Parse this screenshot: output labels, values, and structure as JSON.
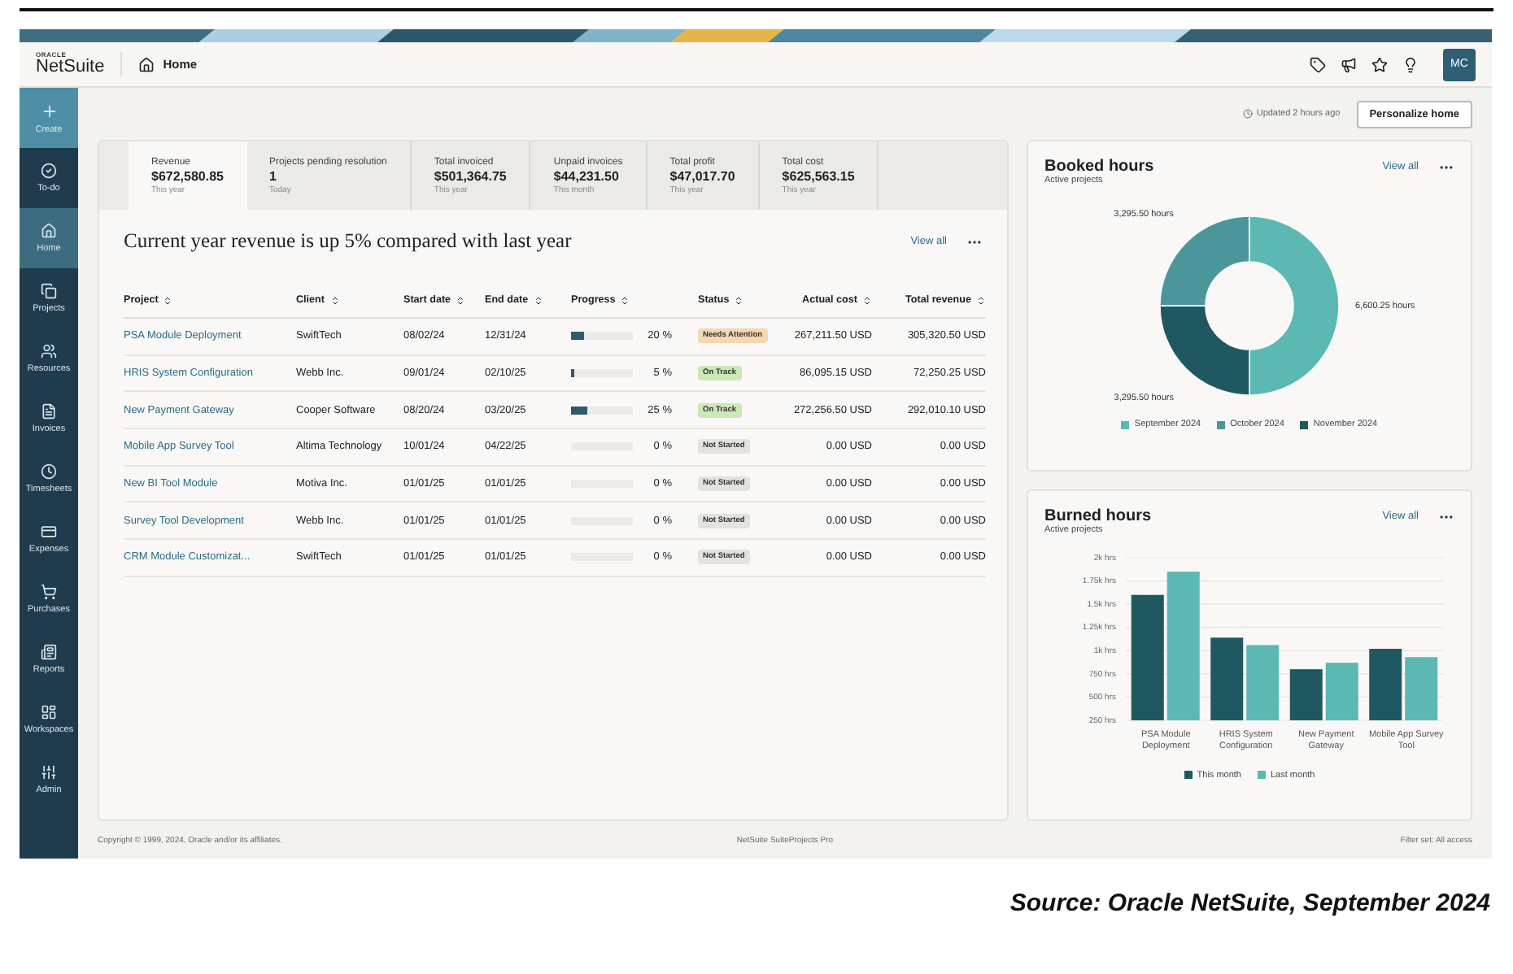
{
  "header": {
    "logo": {
      "company": "ORACLE",
      "product": "NetSuite"
    },
    "page": "Home",
    "avatar": "MC"
  },
  "sidebar": {
    "create": "Create",
    "items": [
      {
        "label": "To-do",
        "selected": false
      },
      {
        "label": "Home",
        "selected": true
      },
      {
        "label": "Projects",
        "selected": false
      },
      {
        "label": "Resources",
        "selected": false
      },
      {
        "label": "Invoices",
        "selected": false
      },
      {
        "label": "Timesheets",
        "selected": false
      },
      {
        "label": "Expenses",
        "selected": false
      },
      {
        "label": "Purchases",
        "selected": false
      },
      {
        "label": "Reports",
        "selected": false
      },
      {
        "label": "Workspaces",
        "selected": false
      },
      {
        "label": "Admin",
        "selected": false
      }
    ]
  },
  "toolbar": {
    "updated": "Updated 2 hours ago",
    "button": "Personalize home"
  },
  "summary_tabs": [
    {
      "label": "Revenue",
      "value": "$672,580.85",
      "period": "This year",
      "selected": true
    },
    {
      "label": "Projects pending resolution",
      "value": "1",
      "period": "Today",
      "selected": false
    },
    {
      "label": "Total invoiced",
      "value": "$501,364.75",
      "period": "This year",
      "selected": false
    },
    {
      "label": "Unpaid invoices",
      "value": "$44,231.50",
      "period": "This month",
      "selected": false
    },
    {
      "label": "Total profit",
      "value": "$47,017.70",
      "period": "This year",
      "selected": false
    },
    {
      "label": "Total cost",
      "value": "$625,563.15",
      "period": "This year",
      "selected": false
    }
  ],
  "revenue_card": {
    "heading": "Current year revenue is up 5% compared with last year",
    "view_all": "View all",
    "columns": [
      "Project",
      "Client",
      "Start date",
      "End date",
      "Progress",
      "Status",
      "Actual cost",
      "Total revenue"
    ],
    "rows": [
      {
        "project": "PSA Module Deployment",
        "client": "SwiftTech",
        "start": "08/02/24",
        "end": "12/31/24",
        "progress": {
          "level": 0.2,
          "reading": "20 %"
        },
        "status": {
          "label": "Needs Attention",
          "color": "#f6d7b0"
        },
        "actual_cost": "267,211.50 USD",
        "total_revenue": "305,320.50 USD"
      },
      {
        "project": "HRIS System Configuration",
        "client": "Webb Inc.",
        "start": "09/01/24",
        "end": "02/10/25",
        "progress": {
          "level": 0.05,
          "reading": "5 %"
        },
        "status": {
          "label": "On Track",
          "color": "#cbe9b4"
        },
        "actual_cost": "86,095.15 USD",
        "total_revenue": "72,250.25 USD"
      },
      {
        "project": "New Payment Gateway",
        "client": "Cooper Software",
        "start": "08/20/24",
        "end": "03/20/25",
        "progress": {
          "level": 0.25,
          "reading": "25 %"
        },
        "status": {
          "label": "On Track",
          "color": "#cbe9b4"
        },
        "actual_cost": "272,256.50 USD",
        "total_revenue": "292,010.10 USD"
      },
      {
        "project": "Mobile App Survey Tool",
        "client": "Altima Technology",
        "start": "10/01/24",
        "end": "04/22/25",
        "progress": {
          "level": 0,
          "reading": "0 %"
        },
        "status": {
          "label": "Not Started",
          "color": "#e3e2df"
        },
        "actual_cost": "0.00 USD",
        "total_revenue": "0.00 USD"
      },
      {
        "project": "New BI Tool Module",
        "client": "Motiva Inc.",
        "start": "01/01/25",
        "end": "01/01/25",
        "progress": {
          "level": 0,
          "reading": "0 %"
        },
        "status": {
          "label": "Not Started",
          "color": "#e3e2df"
        },
        "actual_cost": "0.00 USD",
        "total_revenue": "0.00 USD"
      },
      {
        "project": "Survey Tool Development",
        "client": "Webb Inc.",
        "start": "01/01/25",
        "end": "01/01/25",
        "progress": {
          "level": 0,
          "reading": "0 %"
        },
        "status": {
          "label": "Not Started",
          "color": "#e3e2df"
        },
        "actual_cost": "0.00 USD",
        "total_revenue": "0.00 USD"
      },
      {
        "project": "CRM Module Customizat...",
        "client": "SwiftTech",
        "start": "01/01/25",
        "end": "01/01/25",
        "progress": {
          "level": 0,
          "reading": "0 %"
        },
        "status": {
          "label": "Not Started",
          "color": "#e3e2df"
        },
        "actual_cost": "0.00 USD",
        "total_revenue": "0.00 USD"
      }
    ]
  },
  "booked_hours": {
    "title": "Booked hours",
    "subtitle": "Active projects",
    "view_all": "View all",
    "chart_data": {
      "type": "donut",
      "categories": [
        "September 2024",
        "October 2024",
        "November 2024"
      ],
      "series": [
        {
          "values": [
            50.04,
            24.98,
            24.98
          ]
        }
      ],
      "colors": [
        "#5bb8b3",
        "#4b969b",
        "#1f5860"
      ],
      "legend": true,
      "value_labels": [
        "6,600.25 hours",
        "3,295.50 hours",
        "3,295.50 hours"
      ]
    }
  },
  "burned_hours": {
    "title": "Burned hours",
    "subtitle": "Active projects",
    "view_all": "View all",
    "chart_data": {
      "type": "bar",
      "categories": [
        "PSA Module Deployment",
        "HRIS System Configuration",
        "New Payment Gateway",
        "Mobile App Survey Tool"
      ],
      "series": [
        {
          "name": "This month",
          "color": "#1f5860",
          "values": [
            1600,
            1140,
            800,
            1020
          ]
        },
        {
          "name": "Last month",
          "color": "#5bb8b3",
          "values": [
            1850,
            1060,
            870,
            930
          ]
        }
      ],
      "ylim": [
        250,
        2000
      ],
      "grid": true,
      "legend": true,
      "yticks": [
        {
          "value": 250,
          "label": "250 hrs"
        },
        {
          "value": 500,
          "label": "500 hrs"
        },
        {
          "value": 750,
          "label": "750 hrs"
        },
        {
          "value": 1000,
          "label": "1k hrs"
        },
        {
          "value": 1250,
          "label": "1.25k hrs"
        },
        {
          "value": 1500,
          "label": "1.5k hrs"
        },
        {
          "value": 1750,
          "label": "1.75k hrs"
        },
        {
          "value": 2000,
          "label": "2k hrs"
        }
      ]
    }
  },
  "footer": {
    "copyright": "Copyright © 1999, 2024, Oracle and/or its affiliates.",
    "product": "NetSuite SuiteProjects Pro",
    "filter": "Filter set: All access"
  },
  "caption": "Source: Oracle NetSuite, September 2024"
}
